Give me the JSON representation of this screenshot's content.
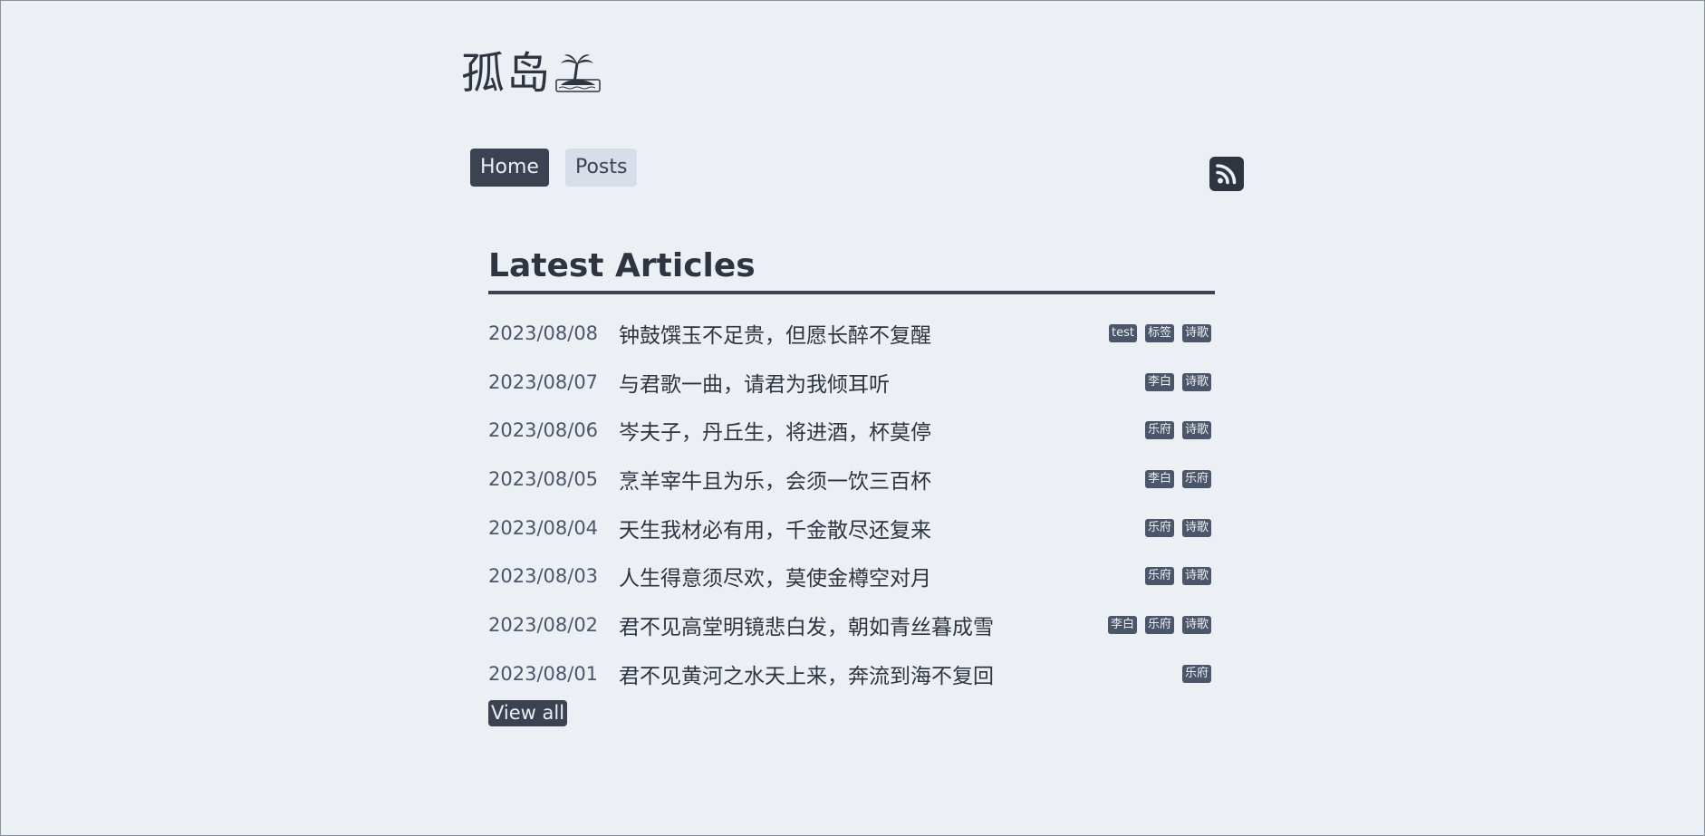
{
  "site": {
    "title": "孤岛",
    "logo_icon": "island-icon"
  },
  "nav": {
    "items": [
      {
        "label": "Home",
        "active": true
      },
      {
        "label": "Posts",
        "active": false
      }
    ],
    "rss_icon": "rss-icon"
  },
  "main": {
    "section_title": "Latest Articles",
    "articles": [
      {
        "date": "2023/08/08",
        "title": "钟鼓馔玉不足贵，但愿长醉不复醒",
        "tags": [
          "test",
          "标签",
          "诗歌"
        ]
      },
      {
        "date": "2023/08/07",
        "title": "与君歌一曲，请君为我倾耳听",
        "tags": [
          "李白",
          "诗歌"
        ]
      },
      {
        "date": "2023/08/06",
        "title": "岑夫子，丹丘生，将进酒，杯莫停",
        "tags": [
          "乐府",
          "诗歌"
        ]
      },
      {
        "date": "2023/08/05",
        "title": "烹羊宰牛且为乐，会须一饮三百杯",
        "tags": [
          "李白",
          "乐府"
        ]
      },
      {
        "date": "2023/08/04",
        "title": "天生我材必有用，千金散尽还复来",
        "tags": [
          "乐府",
          "诗歌"
        ]
      },
      {
        "date": "2023/08/03",
        "title": "人生得意须尽欢，莫使金樽空对月",
        "tags": [
          "乐府",
          "诗歌"
        ]
      },
      {
        "date": "2023/08/02",
        "title": "君不见高堂明镜悲白发，朝如青丝暮成雪",
        "tags": [
          "李白",
          "乐府",
          "诗歌"
        ]
      },
      {
        "date": "2023/08/01",
        "title": "君不见黄河之水天上来，奔流到海不复回",
        "tags": [
          "乐府"
        ]
      }
    ],
    "view_all_label": "View all"
  },
  "colors": {
    "background": "#ECEFF4",
    "text": "#2E3440",
    "accent_dark": "#3B4252",
    "tag_bg": "#4C566A",
    "inactive_btn": "#D8DEE9"
  }
}
